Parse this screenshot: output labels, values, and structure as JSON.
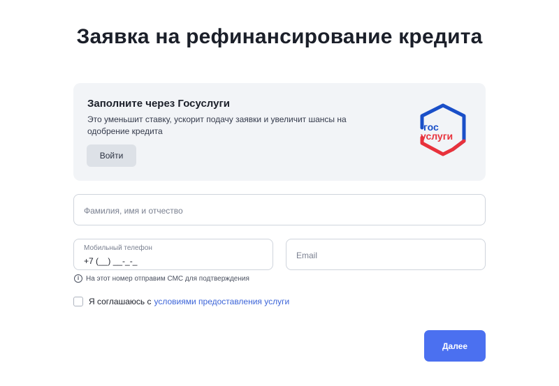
{
  "page": {
    "title": "Заявка на рефинансирование кредита"
  },
  "gosuslugi": {
    "title": "Заполните через Госуслуги",
    "description": "Это уменьшит ставку, ускорит подачу заявки и увеличит шансы на одобрение кредита",
    "login_label": "Войти",
    "logo_line1": "гос",
    "logo_line2": "услуги"
  },
  "form": {
    "fio_placeholder": "Фамилия, имя и отчество",
    "phone_label": "Мобильный телефон",
    "phone_value": "+7 (__) __-_-_",
    "email_placeholder": "Email",
    "phone_hint": "На этот номер отправим СМС для подтверждения",
    "consent_text": "Я соглашаюсь с",
    "consent_link": "условиями предоставления услуги",
    "next_label": "Далее"
  },
  "colors": {
    "accent": "#4b70f0",
    "link": "#3b64d8",
    "logo_blue": "#1a4fc8",
    "logo_red": "#e8323c"
  }
}
